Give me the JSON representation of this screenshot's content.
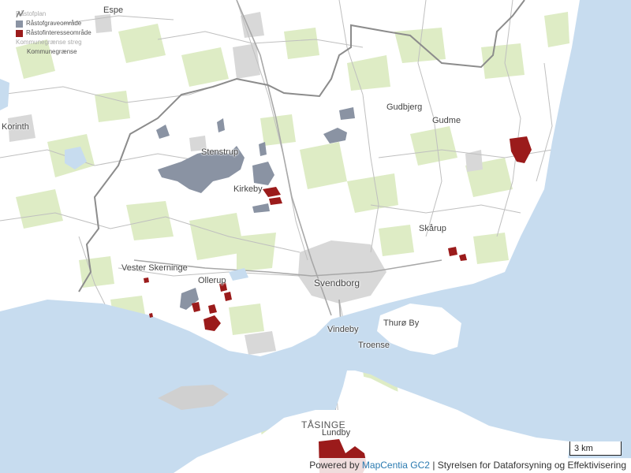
{
  "legend": {
    "title": "Råstofplan",
    "items": [
      {
        "label": "Råstofgraveområde",
        "color": "#8a93a3"
      },
      {
        "label": "Råstofinteresseområde",
        "color": "#9b1b1b"
      }
    ],
    "border_item": {
      "label": "Kommunegrænse streg"
    },
    "border_line": {
      "label": "Kommunegrænse"
    }
  },
  "places": {
    "espe": "Espe",
    "korinth": "Korinth",
    "gudbjerg": "Gudbjerg",
    "gudme": "Gudme",
    "stenstrup": "Stenstrup",
    "kirkeby": "Kirkeby",
    "skarup": "Skårup",
    "vester_skerninge": "Vester Skerninge",
    "ollerup": "Ollerup",
    "svendborg": "Svendborg",
    "thuro_by": "Thurø By",
    "vindeby": "Vindeby",
    "troense": "Troense",
    "tasinge": "TÅSINGE",
    "lundby": "Lundby"
  },
  "scale": {
    "label": "3 km"
  },
  "attribution": {
    "prefix": "Powered by",
    "link": "MapCentia GC2",
    "suffix": "| Styrelsen for Dataforsyning og Effektivisering"
  },
  "colors": {
    "land": "#ffffff",
    "water": "#c7dcef",
    "forest": "#deecc5",
    "urban": "#d8d8d8",
    "road": "#bfbfbf",
    "border": "#8c8c8c",
    "gravel": "#8a93a3",
    "interest": "#9b1b1b"
  },
  "icons": {
    "border_line_icon": "diagonal-line-icon"
  }
}
